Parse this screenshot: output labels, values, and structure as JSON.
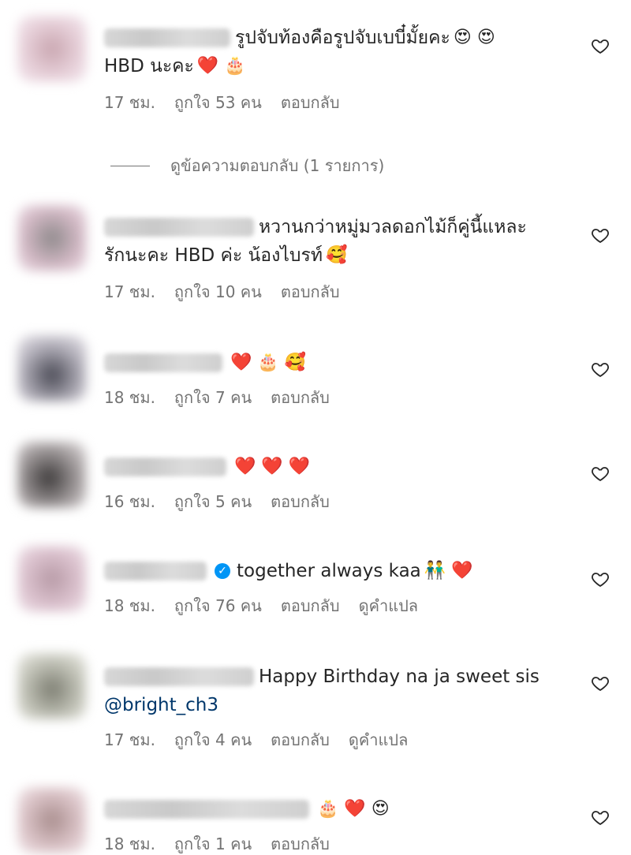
{
  "comments": [
    {
      "text_line1": "รูปจับท้องคือรูปจับเบบี๋มั้ยคะ",
      "emoji_line1": "😍 😍",
      "text_line2": "HBD นะคะ",
      "emoji_line2": "❤️ 🎂",
      "time": "17 ชม.",
      "likes": "ถูกใจ 53 คน",
      "reply": "ตอบกลับ"
    },
    {
      "text_line1": "หวานกว่าหมู่มวลดอกไม้ก็คู่นี้แหละ",
      "text_line2": "รักนะคะ HBD ค่ะ น้องไบรท์",
      "emoji_line2": "🥰",
      "time": "17 ชม.",
      "likes": "ถูกใจ 10 คน",
      "reply": "ตอบกลับ"
    },
    {
      "emoji_line1": "❤️ 🎂 🥰",
      "time": "18 ชม.",
      "likes": "ถูกใจ 7 คน",
      "reply": "ตอบกลับ"
    },
    {
      "emoji_line1": "❤️ ❤️ ❤️",
      "time": "16 ชม.",
      "likes": "ถูกใจ 5 คน",
      "reply": "ตอบกลับ"
    },
    {
      "text_line1": "together always kaa",
      "emoji_line1": "👬 ❤️",
      "time": "18 ชม.",
      "likes": "ถูกใจ 76 คน",
      "reply": "ตอบกลับ",
      "translate": "ดูคำแปล"
    },
    {
      "text_line1": "Happy Birthday na ja sweet sis",
      "mention": "@bright_ch3",
      "time": "17 ชม.",
      "likes": "ถูกใจ 4 คน",
      "reply": "ตอบกลับ",
      "translate": "ดูคำแปล"
    },
    {
      "emoji_line1": "🎂 ❤️ 😍",
      "time": "18 ชม.",
      "likes": "ถูกใจ 1 คน",
      "reply": "ตอบกลับ"
    }
  ],
  "view_replies": "ดูข้อความตอบกลับ (1 รายการ)",
  "colors": {
    "text": "#262626",
    "meta": "#737373",
    "mention": "#00376b",
    "verified": "#0095f6"
  },
  "icons": {
    "like": "heart-outline-icon",
    "verified": "verified-badge-icon"
  }
}
